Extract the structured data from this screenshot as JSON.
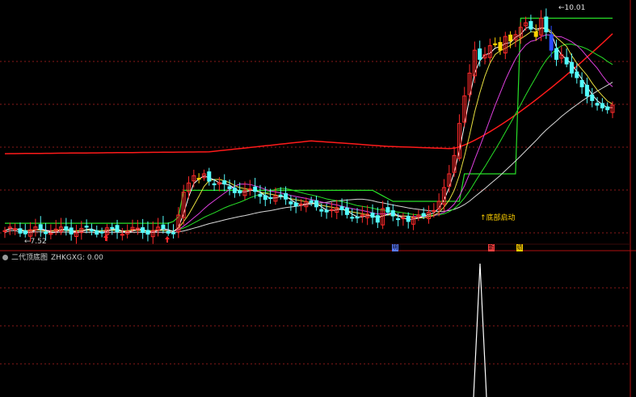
{
  "app": {
    "main_panel_legend": [
      "",
      "",
      "",
      "",
      "",
      "",
      ""
    ],
    "sub_indicator_name": "二代顶底图",
    "sub_indicator_field": "ZHKGXG: 0.00"
  },
  "price_labels": {
    "low": "7.52",
    "high": "10.01"
  },
  "signal_label": "底部启动",
  "markers": [
    {
      "id": "m1",
      "text": "明",
      "color": "#5a7cff"
    },
    {
      "id": "m2",
      "text": "新",
      "color": "#ff4040"
    },
    {
      "id": "m3",
      "text": "绩",
      "color": "#ffd000"
    }
  ],
  "colors": {
    "background": "#000000",
    "grid": "#8a1a1a",
    "candle_up": "#ff2a2a",
    "candle_down": "#54fcfc",
    "highlight_yellow": "#ffd400",
    "highlight_blue": "#2b4bff",
    "ma_red": "#ff1a1a",
    "ma_green": "#28e028",
    "ma_magenta": "#e040e0",
    "ma_yellow": "#e8e040",
    "ma_white": "#d8d8d8",
    "panel_border": "#b01010",
    "sub_signal": "#ffffff"
  },
  "price_range": [
    7.52,
    10.01
  ],
  "chart_data": {
    "type": "candlestick",
    "series_count": 120
  },
  "icons": [
    "panel-dot-icon",
    "low-arrow-icon",
    "high-arrow-icon",
    "signal-arrow-icon"
  ]
}
